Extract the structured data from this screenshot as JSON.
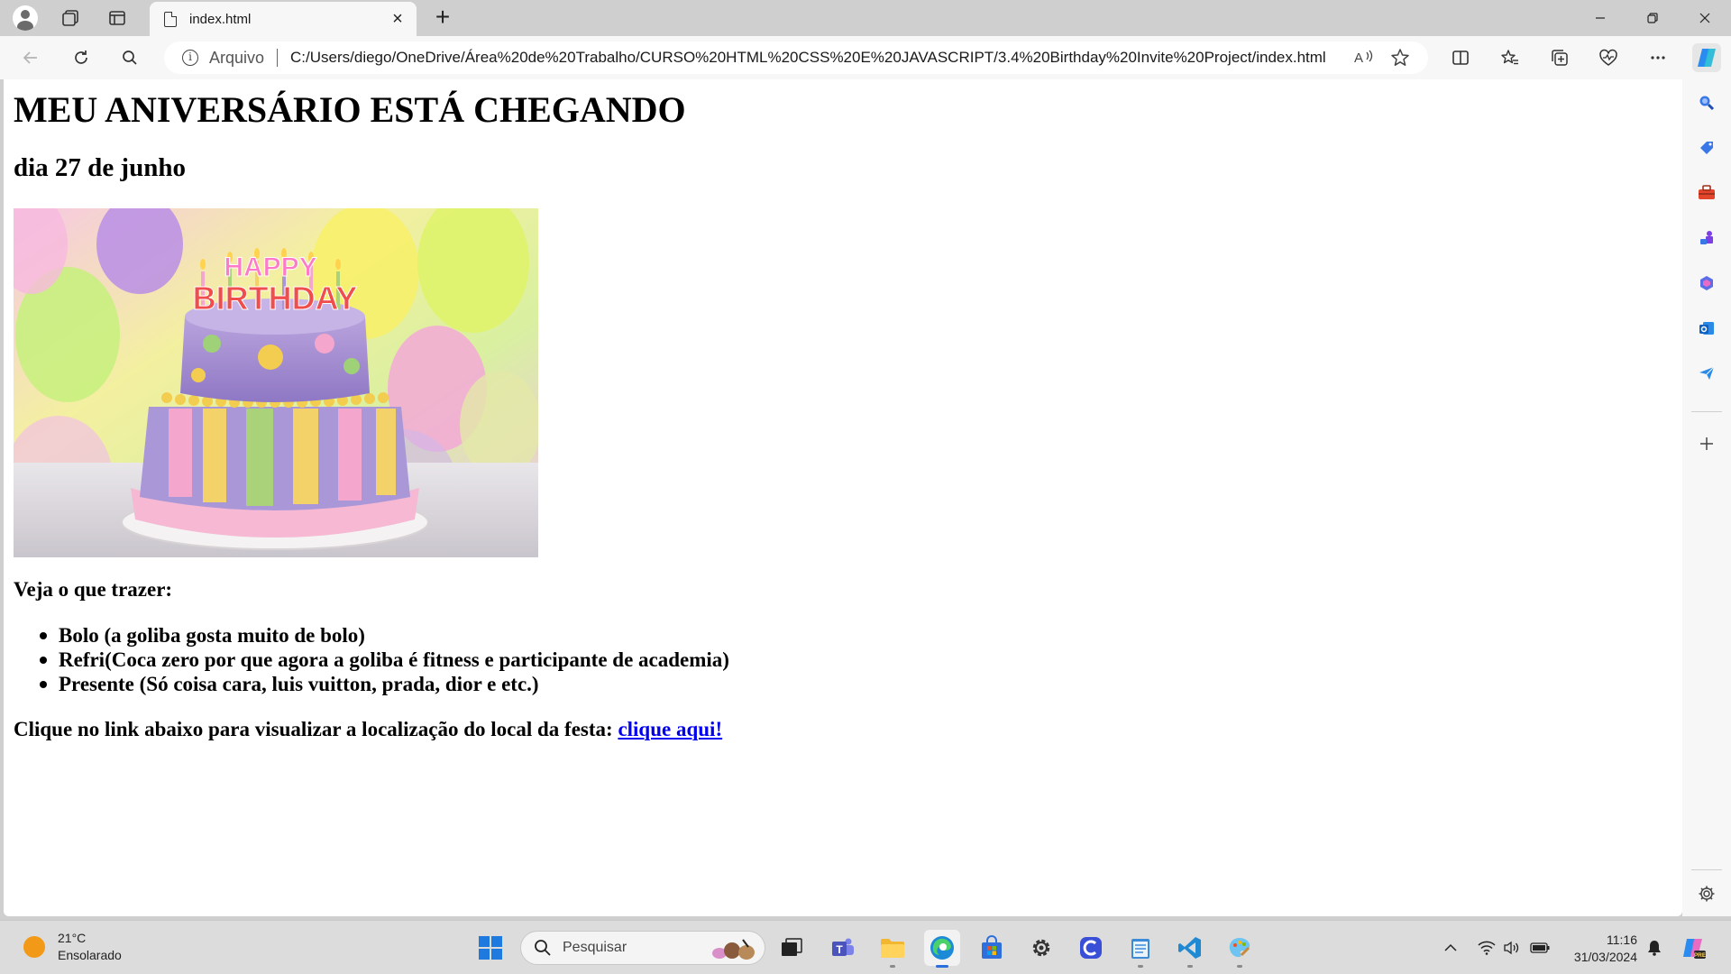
{
  "browser": {
    "tab_title": "index.html",
    "site_label": "Arquivo",
    "url": "C:/Users/diego/OneDrive/Área%20de%20Trabalho/CURSO%20HTML%20CSS%20E%20JAVASCRIPT/3.4%20Birthday%20Invite%20Project/index.html"
  },
  "page": {
    "heading": "MEU ANIVERSÁRIO ESTÁ CHEGANDO",
    "date": "dia 27 de junho",
    "image_text": "HAPPY BIRTHDAY",
    "bring_title": "Veja o que trazer:",
    "items": [
      "Bolo (a goliba gosta muito de bolo)",
      "Refri(Coca zero por que agora a goliba é fitness e participante de academia)",
      "Presente (Só coisa cara, luis vuitton, prada, dior e etc.)"
    ],
    "location_text": "Clique no link abaixo para visualizar a localização do local da festa:",
    "location_link": "clique aqui!"
  },
  "taskbar": {
    "weather_temp": "21°C",
    "weather_desc": "Ensolarado",
    "search_placeholder": "Pesquisar",
    "time": "11:16",
    "date": "31/03/2024"
  },
  "colors": {
    "link": "#0000ee",
    "weather_sun": "#f29a18",
    "edge_accent": "#2a6fdb"
  }
}
